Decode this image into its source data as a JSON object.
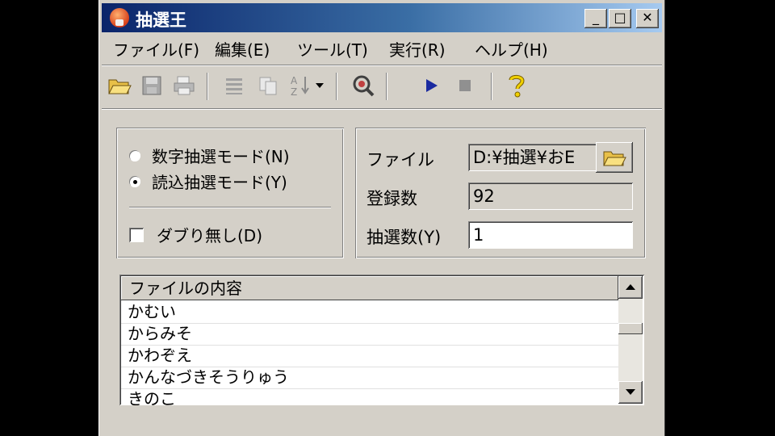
{
  "window": {
    "title": "抽選王",
    "minimize": "_",
    "maximize": "□",
    "close": "✕"
  },
  "menu": [
    {
      "label": "ファイル(F)"
    },
    {
      "label": "編集(E)"
    },
    {
      "label": "ツール(T)"
    },
    {
      "label": "実行(R)"
    },
    {
      "label": "ヘルプ(H)"
    }
  ],
  "toolbar": {
    "icons": [
      "open-folder-icon",
      "save-icon",
      "print-icon",
      "list-icon",
      "copy-icon",
      "sort-az-icon",
      "dropdown-arrow-icon",
      "settings-icon",
      "play-icon",
      "stop-icon",
      "help-icon"
    ],
    "accent_play": "#1a2aa0",
    "accent_help": "#f0d000"
  },
  "mode": {
    "numeric_label": "数字抽選モード(N)",
    "read_label": "読込抽選モード(Y)",
    "selected": "read",
    "no_duplicates_label": "ダブり無し(D)",
    "no_duplicates_checked": false
  },
  "file": {
    "file_label": "ファイル",
    "file_value": "D:¥抽選¥おE",
    "count_label": "登録数",
    "count_value": "92",
    "draw_label": "抽選数(Y)",
    "draw_value": "1"
  },
  "list": {
    "header": "ファイルの内容",
    "rows": [
      "かむい",
      "からみそ",
      "かわぞえ",
      "かんなづきそうりゅう",
      "きのこ"
    ]
  },
  "colors": {
    "title_start": "#0a246a",
    "title_end": "#a6caf0",
    "face": "#d4d0c8"
  }
}
